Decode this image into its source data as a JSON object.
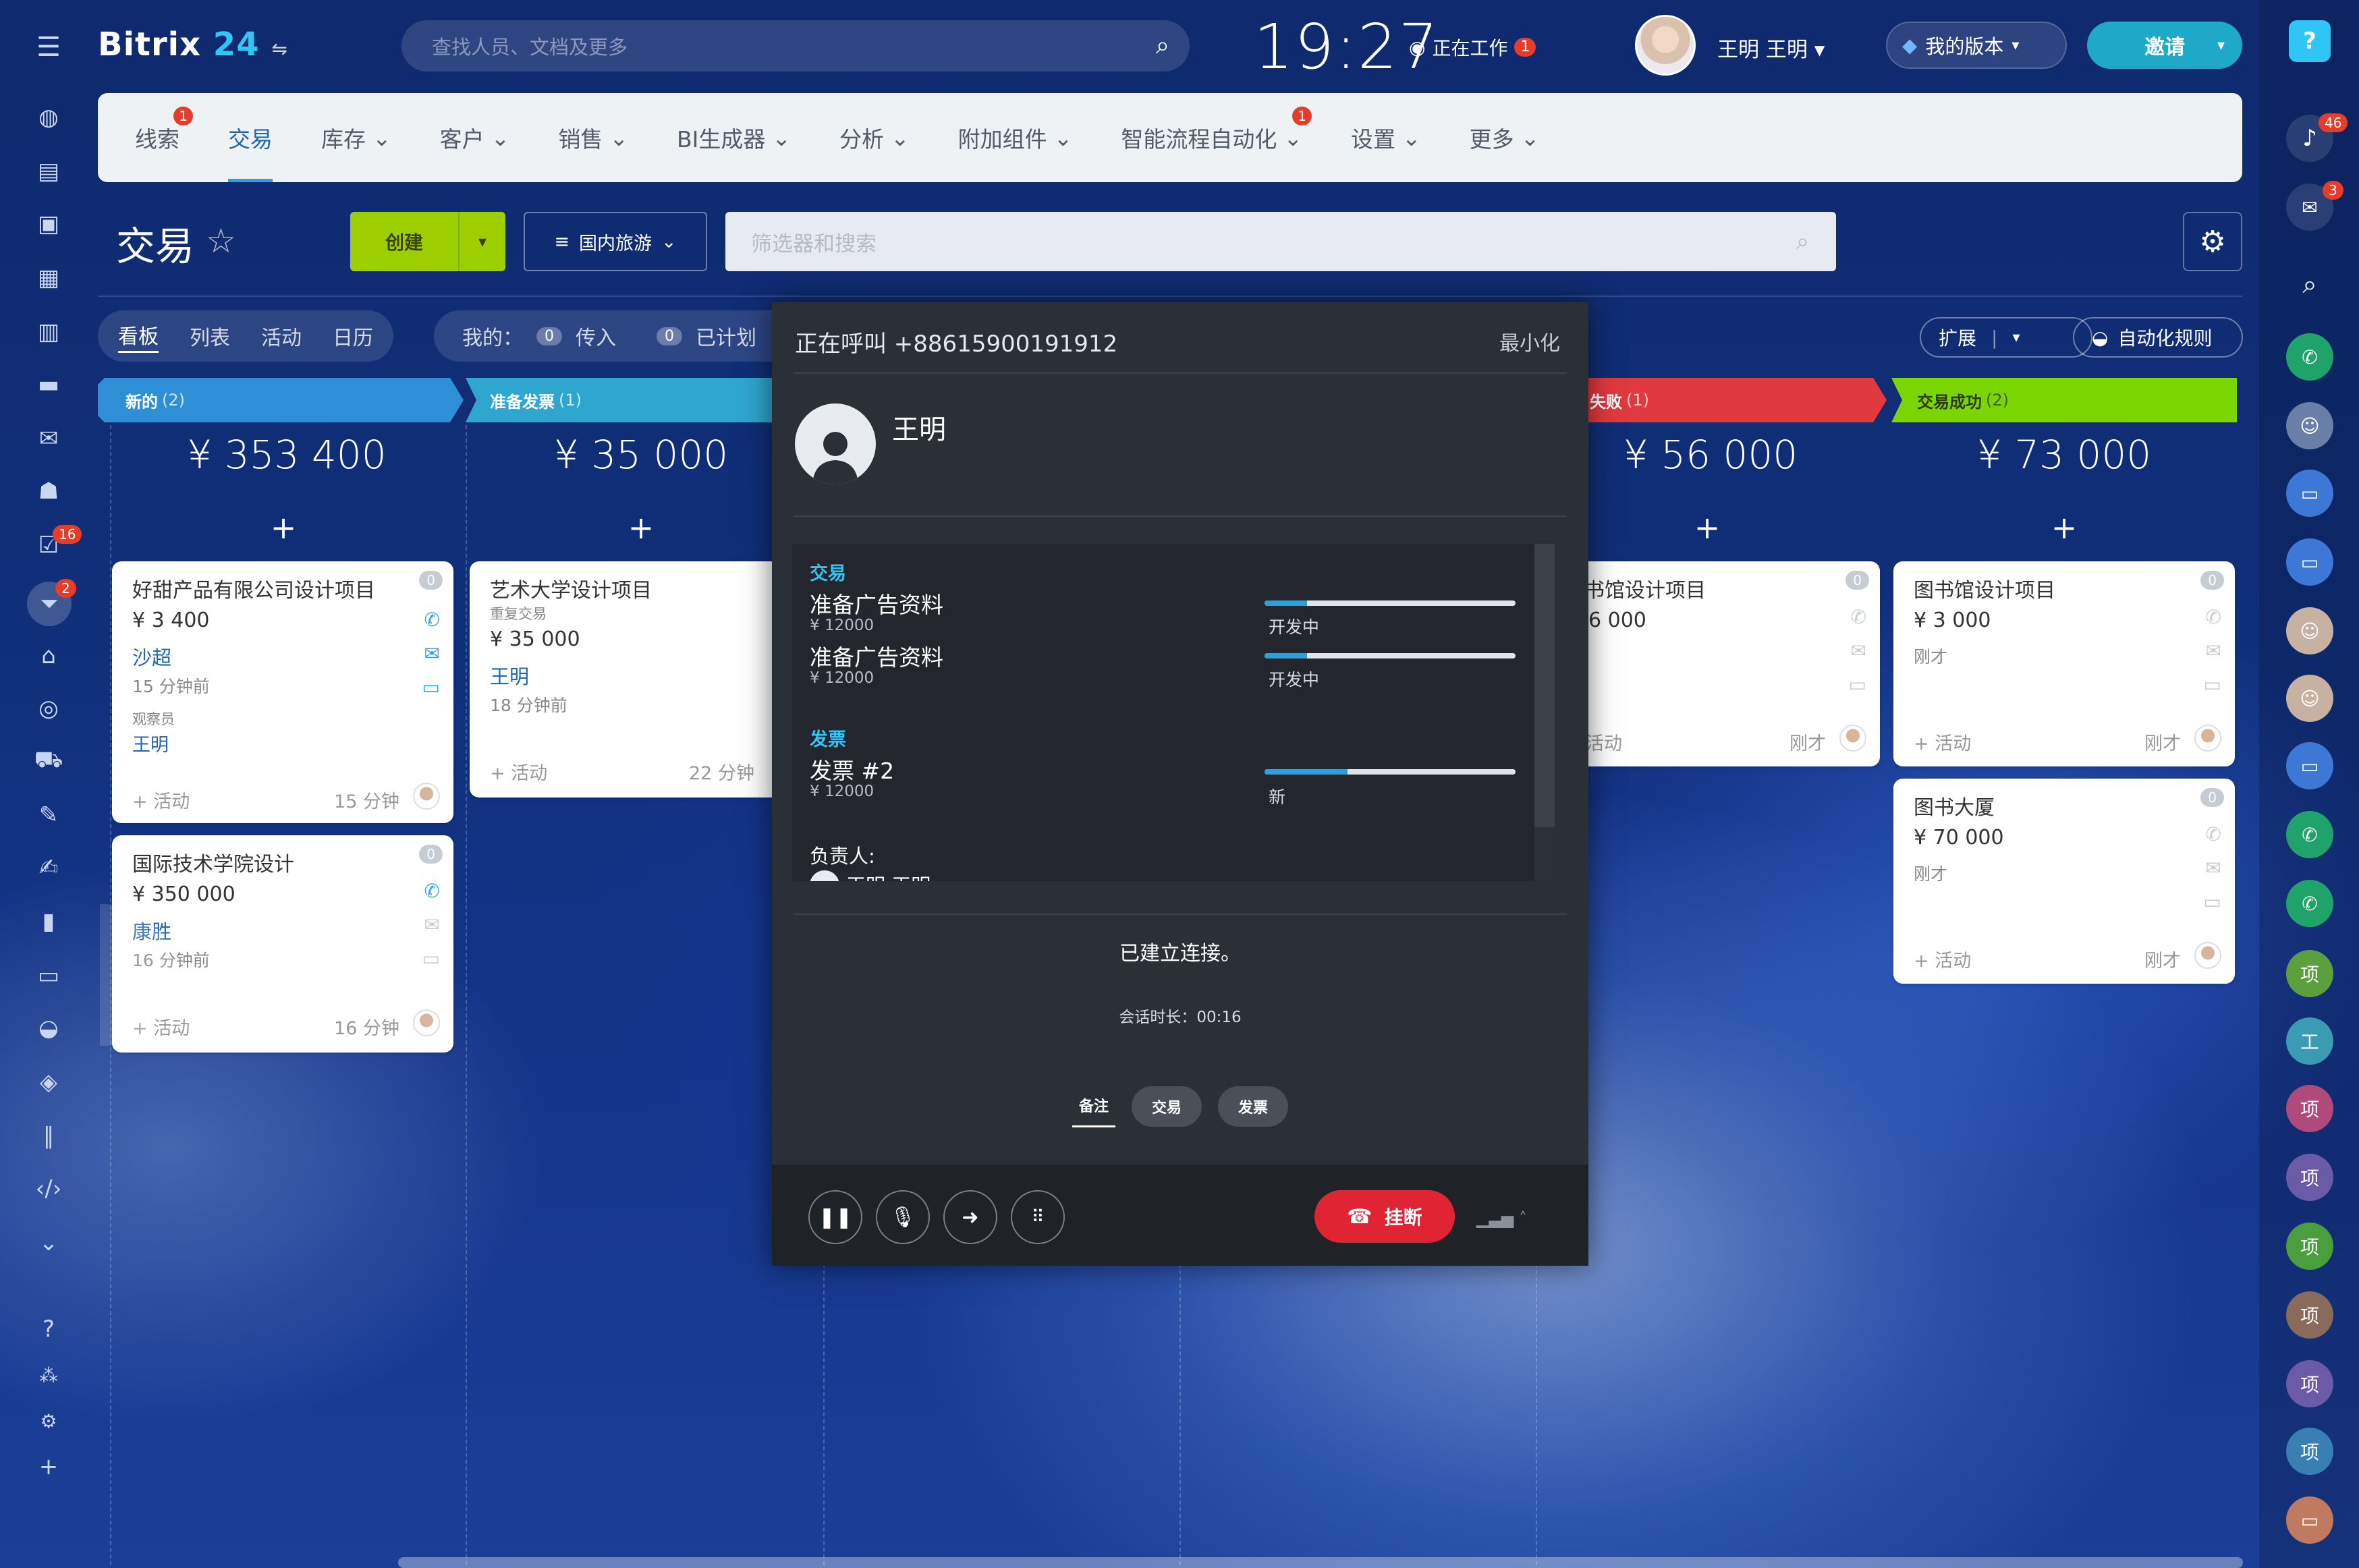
{
  "app": {
    "brand": "Bitrix",
    "brand_num": "24",
    "search_placeholder": "查找人员、文档及更多",
    "clock": "19:27",
    "work_status": "正在工作",
    "work_badge": "1",
    "user": "王明 王明",
    "my_version": "我的版本",
    "invite": "邀请"
  },
  "left_sidebar": {
    "badge_tasks": "16",
    "badge_crm": "2"
  },
  "right_sidebar": {
    "bell_badge": "46",
    "chat_badge": "3",
    "items": [
      "工",
      "项",
      "项",
      "项",
      "项",
      "项",
      "项"
    ]
  },
  "nav": {
    "items": [
      {
        "label": "线索",
        "badge": "1"
      },
      {
        "label": "交易",
        "active": true
      },
      {
        "label": "库存"
      },
      {
        "label": "客户"
      },
      {
        "label": "销售"
      },
      {
        "label": "BI生成器"
      },
      {
        "label": "分析"
      },
      {
        "label": "附加组件"
      },
      {
        "label": "智能流程自动化",
        "badge": "1"
      },
      {
        "label": "设置"
      },
      {
        "label": "更多"
      }
    ]
  },
  "toolbar": {
    "title": "交易",
    "create": "创建",
    "funnel": "国内旅游",
    "filter_placeholder": "筛选器和搜索"
  },
  "views": {
    "tabs": [
      "看板",
      "列表",
      "活动",
      "日历"
    ],
    "active": "看板",
    "my_label": "我的：",
    "incoming_count": "0",
    "incoming": "传入",
    "planned_count": "0",
    "planned": "已计划"
  },
  "actions": {
    "expand": "扩展",
    "automation": "自动化规则"
  },
  "columns": [
    {
      "name": "新的",
      "count": "(2)",
      "sum": "¥ 353 400",
      "color": "#2f8fd6"
    },
    {
      "name": "准备发票",
      "count": "(1)",
      "sum": "¥ 35 000",
      "color": "#2fa6cf"
    },
    {
      "name": "失败",
      "count": "(1)",
      "sum": "¥ 56 000",
      "color": "#e0393e"
    },
    {
      "name": "交易成功",
      "count": "(2)",
      "sum": "¥ 73 000",
      "color": "#7bd500"
    }
  ],
  "cards": {
    "c1": {
      "title": "好甜产品有限公司设计项目",
      "price": "¥ 3 400",
      "contact": "沙超",
      "time": "15 分钟前",
      "observer_label": "观察员",
      "observer": "王明",
      "activity": "+ 活动",
      "ago": "15 分钟",
      "zero": "0"
    },
    "c2": {
      "title": "国际技术学院设计",
      "price": "¥ 350 000",
      "contact": "康胜",
      "time": "16 分钟前",
      "activity": "+ 活动",
      "ago": "16 分钟",
      "zero": "0"
    },
    "c3": {
      "title": "艺术大学设计项目",
      "repeat": "重复交易",
      "price": "¥ 35 000",
      "contact": "王明",
      "time": "18 分钟前",
      "activity": "+ 活动",
      "ago": "22 分钟"
    },
    "c4": {
      "title": "书馆设计项目",
      "price": "6 000",
      "activity": "活动",
      "ago": "刚才",
      "zero": "0"
    },
    "c5": {
      "title": "图书馆设计项目",
      "price": "¥ 3 000",
      "time": "刚才",
      "activity": "+ 活动",
      "ago": "刚才",
      "zero": "0"
    },
    "c6": {
      "title": "图书大厦",
      "price": "¥ 70 000",
      "time": "刚才",
      "activity": "+ 活动",
      "ago": "刚才",
      "zero": "0"
    }
  },
  "call": {
    "title": "正在呼叫 +88615900191912",
    "minimize": "最小化",
    "contact": "王明",
    "deal_section": "交易",
    "invoice_section": "发票",
    "items": [
      {
        "name": "准备广告资料",
        "amount": "¥ 12000",
        "stage": "开发中",
        "progress": 0.17
      },
      {
        "name": "准备广告资料",
        "amount": "¥ 12000",
        "stage": "开发中",
        "progress": 0.17
      },
      {
        "name": "发票 #2",
        "amount": "¥ 12000",
        "stage": "新",
        "progress": 0.33
      }
    ],
    "responsible_label": "负责人:",
    "responsible": "王明 王明",
    "status": "已建立连接。",
    "duration": "会话时长：00:16",
    "tabs": [
      "备注",
      "交易",
      "发票"
    ],
    "hangup": "挂断"
  }
}
